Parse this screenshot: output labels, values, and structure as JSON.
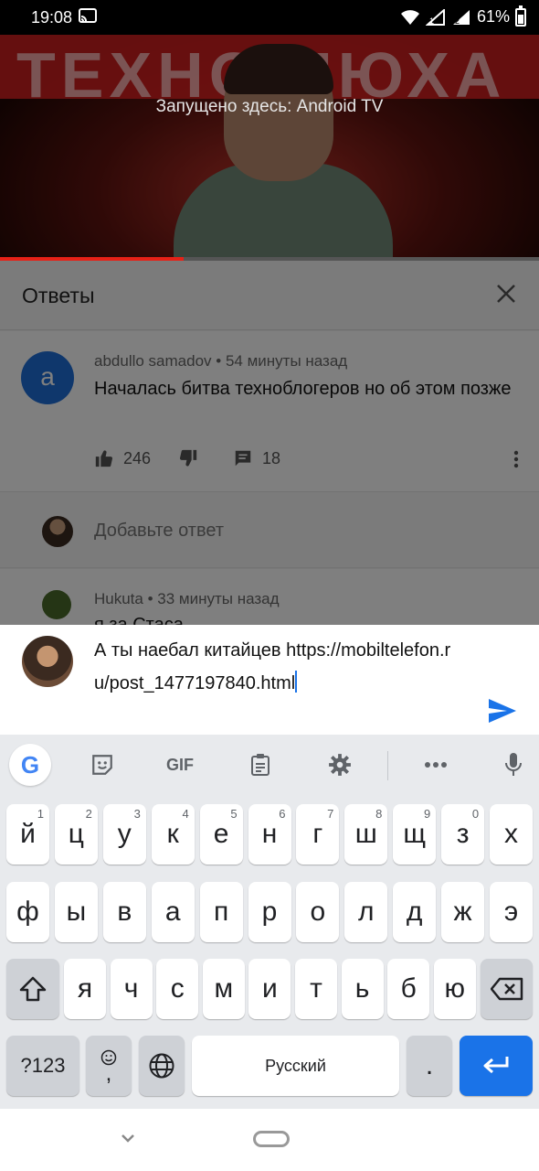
{
  "status": {
    "time": "19:08",
    "battery": "61%"
  },
  "video": {
    "banner_text": "ТЕХНО ЛЮХА",
    "cast_label": "Запущено здесь: Android TV",
    "progress_fraction": 0.34
  },
  "answers": {
    "title": "Ответы"
  },
  "comment": {
    "avatar_letter": "a",
    "author": "abdullo samadov",
    "time": "54 минуты назад",
    "text": "Началась битва техноблогеров но об этом позже",
    "likes": "246",
    "replies": "18"
  },
  "reply_placeholder": "Добавьте ответ",
  "comment2": {
    "author": "Hukuta",
    "time": "33 минуты назад",
    "text": "я за Стаса"
  },
  "compose": {
    "text": "А ты наебал китайцев https://mobiltelefon.ru/post_1477197840.html"
  },
  "keyboard": {
    "toolbar": {
      "google": "G",
      "gif": "GIF"
    },
    "row1": [
      {
        "k": "й",
        "h": "1"
      },
      {
        "k": "ц",
        "h": "2"
      },
      {
        "k": "у",
        "h": "3"
      },
      {
        "k": "к",
        "h": "4"
      },
      {
        "k": "е",
        "h": "5"
      },
      {
        "k": "н",
        "h": "6"
      },
      {
        "k": "г",
        "h": "7"
      },
      {
        "k": "ш",
        "h": "8"
      },
      {
        "k": "щ",
        "h": "9"
      },
      {
        "k": "з",
        "h": "0"
      },
      {
        "k": "х",
        "h": ""
      }
    ],
    "row2": [
      "ф",
      "ы",
      "в",
      "а",
      "п",
      "р",
      "о",
      "л",
      "д",
      "ж",
      "э"
    ],
    "row3": [
      "я",
      "ч",
      "с",
      "м",
      "и",
      "т",
      "ь",
      "б",
      "ю"
    ],
    "symbols": "?123",
    "emoji_comma": ",",
    "space": "Русский",
    "period": "."
  },
  "colors": {
    "accent": "#1a73e8",
    "progress": "#e62117",
    "avatar": "#1e6fd9"
  }
}
